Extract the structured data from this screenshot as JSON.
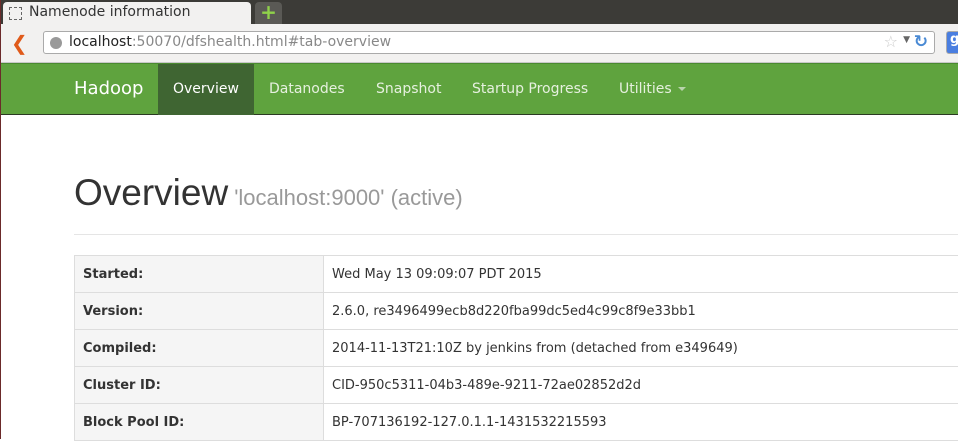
{
  "browser": {
    "tab_title": "Namenode information",
    "url_host": "localhost",
    "url_rest": ":50070/dfshealth.html#tab-overview"
  },
  "navbar": {
    "brand": "Hadoop",
    "items": [
      {
        "label": "Overview"
      },
      {
        "label": "Datanodes"
      },
      {
        "label": "Snapshot"
      },
      {
        "label": "Startup Progress"
      },
      {
        "label": "Utilities"
      }
    ]
  },
  "page": {
    "title": "Overview",
    "subtitle": "'localhost:9000' (active)"
  },
  "info": [
    {
      "key": "Started:",
      "value": "Wed May 13 09:09:07 PDT 2015"
    },
    {
      "key": "Version:",
      "value": "2.6.0, re3496499ecb8d220fba99dc5ed4c99c8f9e33bb1"
    },
    {
      "key": "Compiled:",
      "value": "2014-11-13T21:10Z by jenkins from (detached from e349649)"
    },
    {
      "key": "Cluster ID:",
      "value": "CID-950c5311-04b3-489e-9211-72ae02852d2d"
    },
    {
      "key": "Block Pool ID:",
      "value": "BP-707136192-127.0.1.1-1431532215593"
    }
  ]
}
